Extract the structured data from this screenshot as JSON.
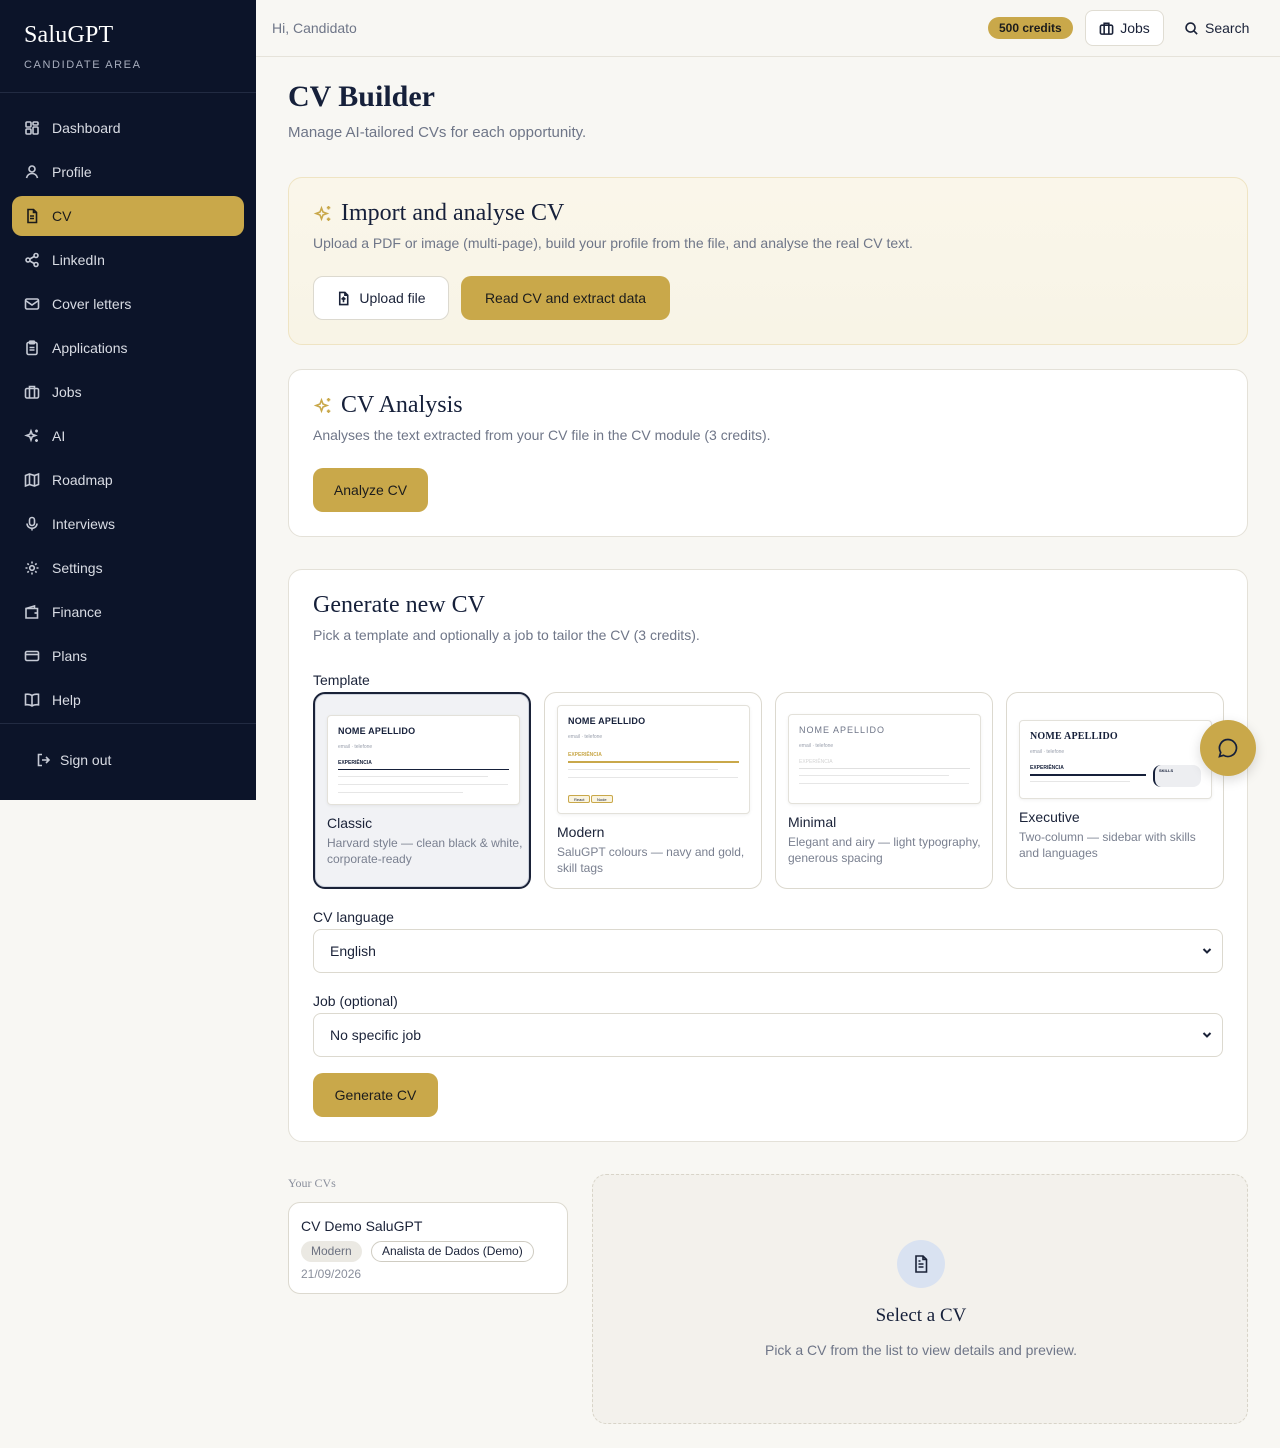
{
  "brand": {
    "name": "SaluGPT",
    "subtitle": "CANDIDATE AREA"
  },
  "sidebar": {
    "items": [
      {
        "label": "Dashboard",
        "icon": "dashboard-icon"
      },
      {
        "label": "Profile",
        "icon": "user-icon"
      },
      {
        "label": "CV",
        "icon": "document-icon",
        "active": true
      },
      {
        "label": "LinkedIn",
        "icon": "share-icon"
      },
      {
        "label": "Cover letters",
        "icon": "mail-icon"
      },
      {
        "label": "Applications",
        "icon": "clipboard-icon"
      },
      {
        "label": "Jobs",
        "icon": "briefcase-icon"
      },
      {
        "label": "AI",
        "icon": "sparkles-icon"
      },
      {
        "label": "Roadmap",
        "icon": "map-icon"
      },
      {
        "label": "Interviews",
        "icon": "mic-icon"
      },
      {
        "label": "Settings",
        "icon": "gear-icon"
      },
      {
        "label": "Finance",
        "icon": "wallet-icon"
      },
      {
        "label": "Plans",
        "icon": "card-icon"
      },
      {
        "label": "Help",
        "icon": "book-icon"
      }
    ],
    "signout": "Sign out"
  },
  "topbar": {
    "greeting": "Hi, Candidato",
    "credits": "500 credits",
    "jobs": "Jobs",
    "search": "Search"
  },
  "page": {
    "title": "CV Builder",
    "subtitle": "Manage AI-tailored CVs for each opportunity."
  },
  "import": {
    "title": "Import and analyse CV",
    "desc": "Upload a PDF or image (multi-page), build your profile from the file, and analyse the real CV text.",
    "upload": "Upload file",
    "read": "Read CV and extract data"
  },
  "analysis": {
    "title": "CV Analysis",
    "desc": "Analyses the text extracted from your CV file in the CV module (3 credits).",
    "button": "Analyze CV"
  },
  "generate": {
    "title": "Generate new CV",
    "desc": "Pick a template and optionally a job to tailor the CV (3 credits).",
    "template_label": "Template",
    "templates": [
      {
        "name": "Classic",
        "desc": "Harvard style — clean black & white, corporate-ready",
        "preview_name": "NOME APELLIDO",
        "preview_contact": "email · telefone",
        "preview_section": "EXPERIÊNCIA"
      },
      {
        "name": "Modern",
        "desc": "SaluGPT colours — navy and gold, skill tags",
        "preview_name": "NOME APELLIDO",
        "preview_contact": "email · telefone",
        "preview_section": "EXPERIÊNCIA",
        "tags": [
          "React",
          "Node"
        ]
      },
      {
        "name": "Minimal",
        "desc": "Elegant and airy — light typography, generous spacing",
        "preview_name": "NOME APELLIDO",
        "preview_contact": "email · telefone",
        "preview_section": "EXPERIÊNCIA"
      },
      {
        "name": "Executive",
        "desc": "Two-column — sidebar with skills and languages",
        "preview_name": "NOME APELLIDO",
        "preview_contact": "email · telefone",
        "preview_section": "EXPERIÊNCIA",
        "preview_side": "SKILLS"
      }
    ],
    "language_label": "CV language",
    "language_value": "English",
    "job_label": "Job (optional)",
    "job_value": "No specific job",
    "button": "Generate CV"
  },
  "cvs": {
    "label": "Your CVs",
    "items": [
      {
        "title": "CV Demo SaluGPT",
        "template": "Modern",
        "job": "Analista de Dados (Demo)",
        "date": "21/09/2026"
      }
    ]
  },
  "preview": {
    "title": "Select a CV",
    "desc": "Pick a CV from the list to view details and preview."
  },
  "colors": {
    "navy": "#0c1429",
    "gold": "#c9a84a",
    "background": "#f8f7f3"
  }
}
